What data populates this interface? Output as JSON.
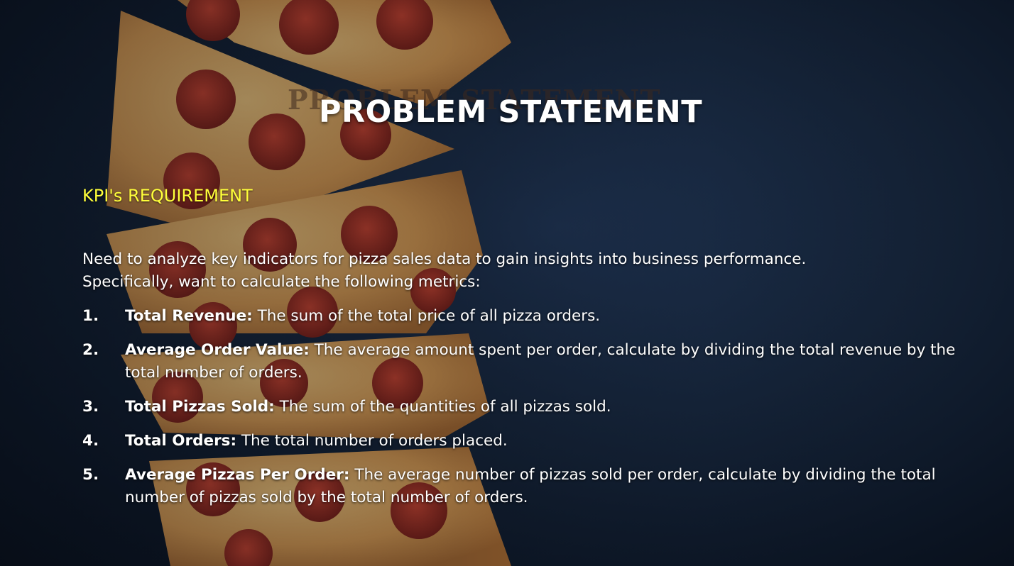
{
  "slide": {
    "title": "PROBLEM STATEMENT",
    "title_ghost": "PROBLEM STATEMENT",
    "subtitle": "KPI's REQUIREMENT",
    "intro_line1": "Need to analyze key indicators for pizza sales data to gain insights into  business performance.",
    "intro_line2": "Specifically,  want to calculate the following metrics:",
    "kpis": [
      {
        "number": "1.",
        "name": "Total Revenue:",
        "desc": "The sum of the total price of all pizza orders."
      },
      {
        "number": "2.",
        "name": "Average Order Value:",
        "desc": "The average amount spent per order, calculate by dividing the total revenue by the total number of orders."
      },
      {
        "number": "3.",
        "name": "Total Pizzas Sold:",
        "desc": "The sum of the quantities of all pizzas sold."
      },
      {
        "number": "4.",
        "name": "Total Orders:",
        "desc": "The total number of orders placed."
      },
      {
        "number": "5.",
        "name": "Average Pizzas Per Order:",
        "desc": "The average number of pizzas sold per order, calculate by dividing the total number of pizzas sold by the total number of orders."
      }
    ]
  },
  "colors": {
    "background": "#142236",
    "title": "#ffffff",
    "subtitle": "#ffff3a",
    "body_text": "#ffffff",
    "crust": "#d9a35a",
    "cheese": "#e8b45c",
    "pepperoni": "#a92e20"
  },
  "icons": [
    "pizza-illustration"
  ]
}
